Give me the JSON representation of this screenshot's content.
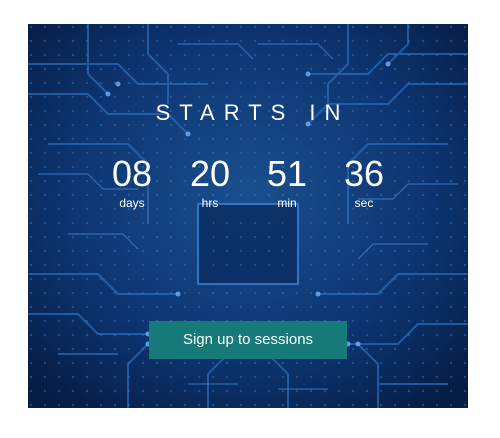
{
  "colors": {
    "background": "#0a2a5c",
    "button": "#157a78",
    "text": "#ffffff"
  },
  "countdown": {
    "title": "STARTS IN",
    "units": [
      {
        "value": "08",
        "label": "days"
      },
      {
        "value": "20",
        "label": "hrs"
      },
      {
        "value": "51",
        "label": "min"
      },
      {
        "value": "36",
        "label": "sec"
      }
    ]
  },
  "cta": {
    "label": "Sign up to sessions"
  }
}
